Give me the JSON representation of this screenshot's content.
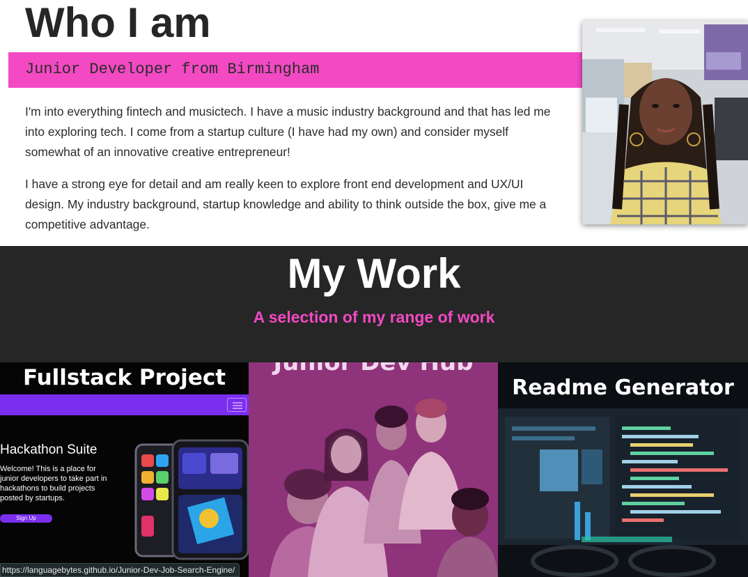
{
  "about": {
    "title": "Who I am",
    "subtitle": "Junior Developer from Birmingham",
    "paragraphs": [
      "I'm into everything fintech and musictech. I have a music industry background and that has led me into exploring tech. I come from a startup culture (I have had my own) and consider myself somewhat of an innovative creative entrepreneur!",
      "I have a strong eye for detail and am really keen to explore front end development and UX/UI design. My industry background, startup knowledge and ability to think outside the box, give me a competitive advantage."
    ]
  },
  "work": {
    "title": "My Work",
    "subtitle": "A selection of my range of work"
  },
  "projects": [
    {
      "title": "Fullstack Project",
      "screenshot": {
        "heading": "Hackathon Suite",
        "text": "Welcome! This is a place for junior developers to take part in hackathons to build projects posted by startups.",
        "button": "Sign Up"
      }
    },
    {
      "title": "Junior Dev Hub"
    },
    {
      "title": "Readme Generator"
    }
  ],
  "status_bar": {
    "url": "https://languagebytes.github.io/Junior-Dev-Job-Search-Engine/"
  },
  "colors": {
    "accent_pink": "#f349c3",
    "dark_band": "#262626",
    "text": "#2b2b2b"
  }
}
